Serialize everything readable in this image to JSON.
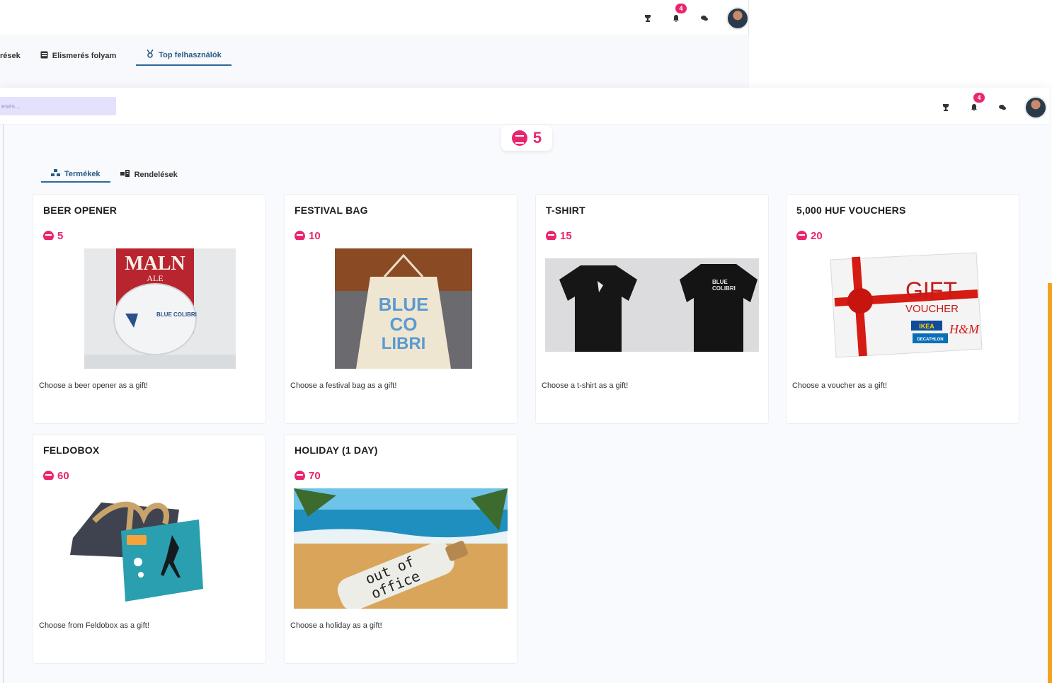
{
  "back_window": {
    "notification_count": "4",
    "tabs": [
      {
        "label": "rések",
        "icon": "none"
      },
      {
        "label": "Elismerés folyam",
        "icon": "feed-icon"
      },
      {
        "label": "Top felhasználók",
        "icon": "medal-icon"
      }
    ]
  },
  "front_window": {
    "search_placeholder": "esés...",
    "notification_count": "4",
    "coin_balance": "5",
    "tabs": [
      {
        "label": "Termékek",
        "icon": "products-icon"
      },
      {
        "label": "Rendelések",
        "icon": "orders-icon"
      }
    ],
    "products": [
      {
        "title": "BEER OPENER",
        "price": "5",
        "description": "Choose a beer opener as a gift!",
        "image": "beer-opener-image"
      },
      {
        "title": "FESTIVAL BAG",
        "price": "10",
        "description": "Choose a festival bag as a gift!",
        "image": "festival-bag-image"
      },
      {
        "title": "T-SHIRT",
        "price": "15",
        "description": "Choose a t-shirt as a gift!",
        "image": "tshirt-image"
      },
      {
        "title": "5,000 HUF VOUCHERS",
        "price": "20",
        "description": "Choose a voucher as a gift!",
        "image": "voucher-image"
      },
      {
        "title": "FELDOBOX",
        "price": "60",
        "description": "Choose from Feldobox as a gift!",
        "image": "feldobox-image"
      },
      {
        "title": "HOLIDAY (1 DAY)",
        "price": "70",
        "description": "Choose a holiday as a gift!",
        "image": "holiday-image"
      }
    ],
    "image_text": {
      "beer_can": "MALN",
      "beer_can_sub": "ALE",
      "brand": "BLUE COLIBRI",
      "bag_line1": "BLUE",
      "bag_line2": "CO",
      "bag_line3": "LIBRI",
      "shirt_brand_line1": "BLUE",
      "shirt_brand_line2": "COLIBRI",
      "gift": "GIFT",
      "voucher": "VOUCHER",
      "ikea": "IKEA",
      "hm": "H&M",
      "decathlon": "DECATHLON",
      "bottle_line1": "out of",
      "bottle_line2": "office"
    }
  },
  "colors": {
    "accent_pink": "#e8266e",
    "tab_blue": "#2a6a9a",
    "search_bg": "#e3e1fb",
    "side_accent": "#f3a21f"
  }
}
